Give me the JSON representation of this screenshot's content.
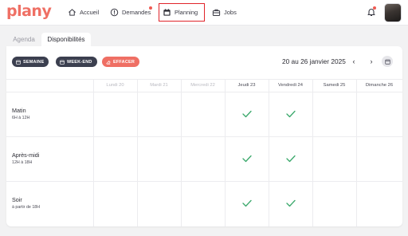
{
  "app": {
    "logo": "plany"
  },
  "nav": {
    "items": [
      {
        "label": "Accueil",
        "icon": "home-icon"
      },
      {
        "label": "Demandes",
        "icon": "alert-circle-icon",
        "has_dot": true
      },
      {
        "label": "Planning",
        "icon": "calendar-icon",
        "active": true
      },
      {
        "label": "Jobs",
        "icon": "briefcase-icon"
      }
    ],
    "bell_icon": "bell-icon",
    "bell_has_dot": true
  },
  "tabs": [
    {
      "label": "Agenda",
      "active": false
    },
    {
      "label": "Disponibilités",
      "active": true
    }
  ],
  "toolbar": {
    "semaine": "SEMAINE",
    "weekend": "WEEK-END",
    "effacer": "EFFACER",
    "date_range": "20 au 26 janvier 2025",
    "prev": "‹",
    "next": "›"
  },
  "days": [
    {
      "label": "Lundi 20",
      "past": true
    },
    {
      "label": "Mardi 21",
      "past": true
    },
    {
      "label": "Mercredi 22",
      "past": true
    },
    {
      "label": "Jeudi 23",
      "past": false
    },
    {
      "label": "Vendredi 24",
      "past": false
    },
    {
      "label": "Samedi 25",
      "past": false
    },
    {
      "label": "Dimanche 26",
      "past": false
    }
  ],
  "slots": [
    {
      "title": "Matin",
      "subtitle": "6H à 12H",
      "available": [
        false,
        false,
        false,
        true,
        true,
        false,
        false
      ]
    },
    {
      "title": "Après-midi",
      "subtitle": "12H à 18H",
      "available": [
        false,
        false,
        false,
        true,
        true,
        false,
        false
      ]
    },
    {
      "title": "Soir",
      "subtitle": "à partir de 18H",
      "available": [
        false,
        false,
        false,
        true,
        true,
        false,
        false
      ]
    }
  ],
  "colors": {
    "brand": "#ef6f64",
    "dark_button": "#3b3f4f",
    "check": "#3aa86b",
    "highlight_border": "#e0242a"
  }
}
